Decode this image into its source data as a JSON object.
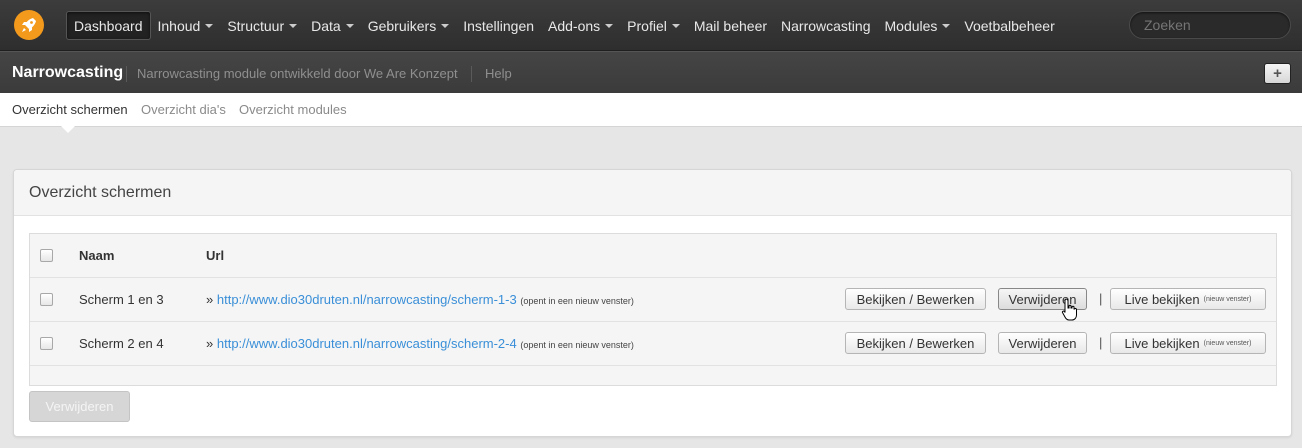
{
  "nav": {
    "logo_icon": "rocket-icon",
    "items": [
      {
        "label": "Dashboard",
        "active": true,
        "dropdown": false
      },
      {
        "label": "Inhoud",
        "dropdown": true
      },
      {
        "label": "Structuur",
        "dropdown": true
      },
      {
        "label": "Data",
        "dropdown": true
      },
      {
        "label": "Gebruikers",
        "dropdown": true
      },
      {
        "label": "Instellingen",
        "dropdown": false
      },
      {
        "label": "Add-ons",
        "dropdown": true
      },
      {
        "label": "Profiel",
        "dropdown": true
      },
      {
        "label": "Mail beheer",
        "dropdown": false
      },
      {
        "label": "Narrowcasting",
        "dropdown": false
      },
      {
        "label": "Modules",
        "dropdown": true
      },
      {
        "label": "Voetbalbeheer",
        "dropdown": false
      }
    ],
    "search_placeholder": "Zoeken"
  },
  "subheader": {
    "title": "Narrowcasting",
    "description": "Narrowcasting module ontwikkeld door We Are Konzept",
    "help": "Help",
    "add_button": "+"
  },
  "tabs": [
    "Overzicht schermen",
    "Overzicht dia's",
    "Overzicht modules"
  ],
  "panel": {
    "title": "Overzicht schermen",
    "columns": {
      "name": "Naam",
      "url": "Url"
    },
    "rows": [
      {
        "name": "Scherm 1 en 3",
        "url_prefix": "»",
        "url": "http://www.dio30druten.nl/narrowcasting/scherm-1-3",
        "note": "(opent in een nieuw venster)",
        "edit": "Bekijken / Bewerken",
        "delete": "Verwijderen",
        "separator": "|",
        "live": "Live bekijken",
        "live_note": "(nieuw venster)"
      },
      {
        "name": "Scherm 2 en 4",
        "url_prefix": "»",
        "url": "http://www.dio30druten.nl/narrowcasting/scherm-2-4",
        "note": "(opent in een nieuw venster)",
        "edit": "Bekijken / Bewerken",
        "delete": "Verwijderen",
        "separator": "|",
        "live": "Live bekijken",
        "live_note": "(nieuw venster)"
      }
    ],
    "bulk_delete": "Verwijderen"
  }
}
